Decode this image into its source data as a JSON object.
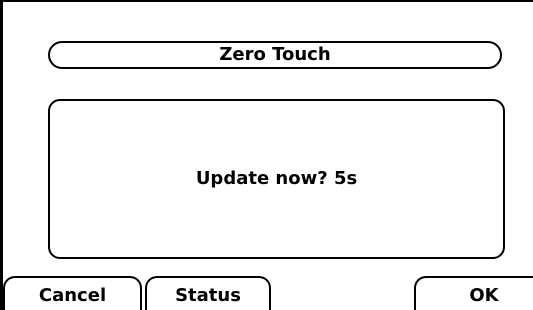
{
  "header": {
    "title": "Zero Touch"
  },
  "dialog": {
    "message": "Update now? 5s"
  },
  "softkeys": {
    "cancel_label": "Cancel",
    "status_label": "Status",
    "ok_label": "OK"
  },
  "colors": {
    "background": "#ffffff",
    "foreground": "#000000"
  }
}
